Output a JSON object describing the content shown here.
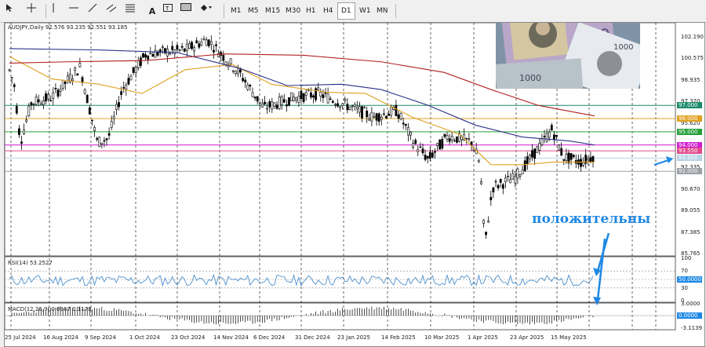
{
  "toolbar": {
    "icons": [
      "cursor-icon",
      "crosshair-icon",
      "vertical-line-icon",
      "horizontal-line-icon",
      "trendline-icon",
      "channel-icon",
      "fibonacci-icon",
      "text-icon",
      "text-label-icon",
      "rectangle-icon",
      "shapes-icon"
    ],
    "timeframes": [
      "M1",
      "M5",
      "M15",
      "M30",
      "H1",
      "H4",
      "D1",
      "W1",
      "MN"
    ],
    "active_timeframe": "D1"
  },
  "main_panel": {
    "header": "AUDJPY,Daily  92.576 93.235 92.551 93.185",
    "price_axis": [
      "102.190",
      "100.575",
      "98.935",
      "97.320",
      "95.620",
      "93.975",
      "92.335",
      "90.670",
      "89.055",
      "87.385",
      "85.765"
    ],
    "level_bubbles": [
      {
        "text": "97.000",
        "color": "#1a8a6a",
        "value": 97.0
      },
      {
        "text": "96.000",
        "color": "#e0a020",
        "value": 96.0
      },
      {
        "text": "95.000",
        "color": "#27a03a",
        "value": 95.0
      },
      {
        "text": "94.000",
        "color": "#d020d0",
        "value": 94.0
      },
      {
        "text": "93.550",
        "color": "#e04b8b",
        "value": 93.55
      },
      {
        "text": "93.000",
        "color": "#b7d3e6",
        "value": 93.0
      },
      {
        "text": "92.000",
        "color": "#9aa0a6",
        "value": 92.0
      }
    ]
  },
  "rsi_panel": {
    "header": "RSI(14) 53.2527",
    "axis": [
      "100",
      "70",
      "50.0000",
      "30",
      "0"
    ]
  },
  "macd_panel": {
    "header": "MACD(12,26,9) 0.0967 0.1170",
    "axis": [
      "3.0000",
      "0.0000",
      "-3.1139"
    ]
  },
  "time_axis": [
    "25 Jul 2024",
    "16 Aug 2024",
    "9 Sep 2024",
    "1 Oct 2024",
    "23 Oct 2024",
    "14 Nov 2024",
    "6 Dec 2024",
    "31 Dec 2024",
    "23 Jan 2025",
    "14 Feb 2025",
    "10 Mar 2025",
    "1 Apr 2025",
    "23 Apr 2025",
    "15 May 2025"
  ],
  "annotation": "положительны",
  "colors": {
    "accent": "#1e88e5",
    "candles": "#000000",
    "ma_fast": "#e0a020",
    "ma_mid": "#2a2f8a",
    "ma_slow": "#b22020",
    "rsi_line": "#3a86c8"
  }
}
